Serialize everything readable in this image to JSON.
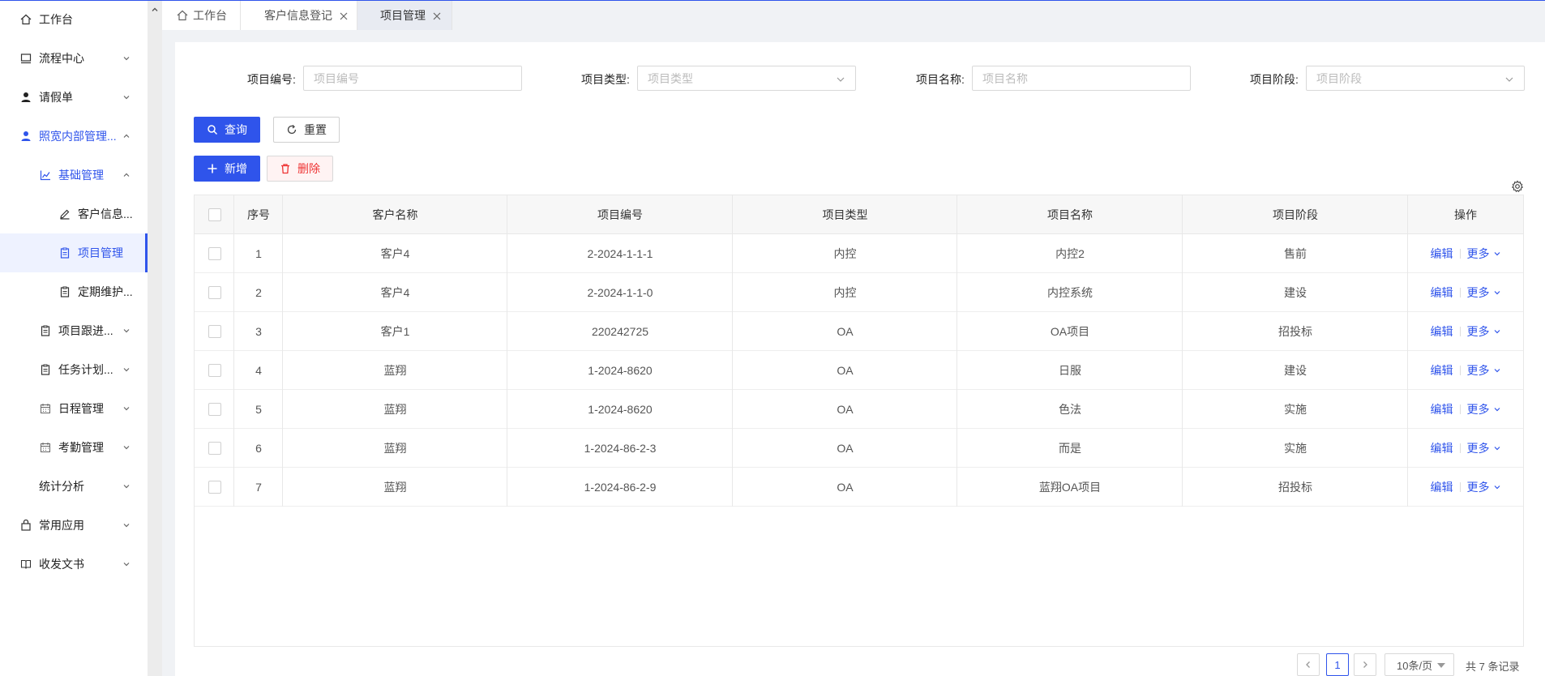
{
  "sidebar": {
    "items": [
      {
        "label": "工作台",
        "icon": "home-icon"
      },
      {
        "label": "流程中心",
        "icon": "monitor-icon"
      },
      {
        "label": "请假单",
        "icon": "user-icon"
      },
      {
        "label": "照宽内部管理...",
        "icon": "user-icon"
      },
      {
        "label": "基础管理",
        "icon": "chart-icon"
      },
      {
        "label": "客户信息...",
        "icon": "edit-icon"
      },
      {
        "label": "项目管理",
        "icon": "clipboard-icon"
      },
      {
        "label": "定期维护...",
        "icon": "clipboard-icon"
      },
      {
        "label": "项目跟进...",
        "icon": "clipboard-icon"
      },
      {
        "label": "任务计划...",
        "icon": "clipboard-icon"
      },
      {
        "label": "日程管理",
        "icon": "calendar-icon"
      },
      {
        "label": "考勤管理",
        "icon": "calendar-icon"
      },
      {
        "label": "统计分析",
        "icon": ""
      },
      {
        "label": "常用应用",
        "icon": "bag-icon"
      },
      {
        "label": "收发文书",
        "icon": "book-icon"
      }
    ]
  },
  "tabs": [
    {
      "label": "工作台"
    },
    {
      "label": "客户信息登记"
    },
    {
      "label": "项目管理"
    }
  ],
  "filters": {
    "project_no_label": "项目编号:",
    "project_no_placeholder": "项目编号",
    "project_type_label": "项目类型:",
    "project_type_placeholder": "项目类型",
    "project_name_label": "项目名称:",
    "project_name_placeholder": "项目名称",
    "project_stage_label": "项目阶段:",
    "project_stage_placeholder": "项目阶段"
  },
  "toolbar": {
    "query_label": "查询",
    "reset_label": "重置",
    "add_label": "新增",
    "delete_label": "删除"
  },
  "table": {
    "headers": [
      "序号",
      "客户名称",
      "项目编号",
      "项目类型",
      "项目名称",
      "项目阶段",
      "操作"
    ],
    "rows": [
      [
        "1",
        "客户4",
        "2-2024-1-1-1",
        "内控",
        "内控2",
        "售前"
      ],
      [
        "2",
        "客户4",
        "2-2024-1-1-0",
        "内控",
        "内控系统",
        "建设"
      ],
      [
        "3",
        "客户1",
        "220242725",
        "OA",
        "OA项目",
        "招投标"
      ],
      [
        "4",
        "蓝翔",
        "1-2024-8620",
        "OA",
        "日服",
        "建设"
      ],
      [
        "5",
        "蓝翔",
        "1-2024-8620",
        "OA",
        "色法",
        "实施"
      ],
      [
        "6",
        "蓝翔",
        "1-2024-86-2-3",
        "OA",
        "而是",
        "实施"
      ],
      [
        "7",
        "蓝翔",
        "1-2024-86-2-9",
        "OA",
        "蓝翔OA项目",
        "招投标"
      ]
    ],
    "edit_label": "编辑",
    "more_label": "更多"
  },
  "pagination": {
    "current_page": "1",
    "page_size": "10条/页",
    "total_text": "共 7 条记录"
  },
  "colors": {
    "primary": "#2f54eb",
    "danger": "#e33333"
  }
}
